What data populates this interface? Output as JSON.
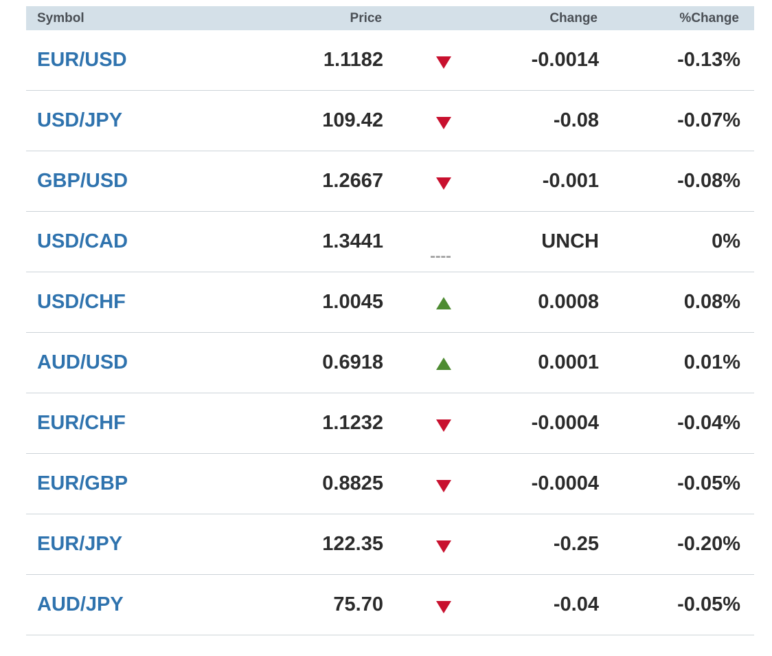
{
  "header": {
    "symbol": "Symbol",
    "price": "Price",
    "change": "Change",
    "pct_change": "%Change"
  },
  "colors": {
    "header_bg": "#d4e0e8",
    "symbol_link": "#2f73ae",
    "down": "#c8102e",
    "up": "#4d8b31",
    "flat": "#a8a8a8"
  },
  "rows": [
    {
      "symbol": "EUR/USD",
      "price": "1.1182",
      "direction": "down",
      "change": "-0.0014",
      "pct_change": "-0.13%"
    },
    {
      "symbol": "USD/JPY",
      "price": "109.42",
      "direction": "down",
      "change": "-0.08",
      "pct_change": "-0.07%"
    },
    {
      "symbol": "GBP/USD",
      "price": "1.2667",
      "direction": "down",
      "change": "-0.001",
      "pct_change": "-0.08%"
    },
    {
      "symbol": "USD/CAD",
      "price": "1.3441",
      "direction": "flat",
      "change": "UNCH",
      "pct_change": "0%"
    },
    {
      "symbol": "USD/CHF",
      "price": "1.0045",
      "direction": "up",
      "change": "0.0008",
      "pct_change": "0.08%"
    },
    {
      "symbol": "AUD/USD",
      "price": "0.6918",
      "direction": "up",
      "change": "0.0001",
      "pct_change": "0.01%"
    },
    {
      "symbol": "EUR/CHF",
      "price": "1.1232",
      "direction": "down",
      "change": "-0.0004",
      "pct_change": "-0.04%"
    },
    {
      "symbol": "EUR/GBP",
      "price": "0.8825",
      "direction": "down",
      "change": "-0.0004",
      "pct_change": "-0.05%"
    },
    {
      "symbol": "EUR/JPY",
      "price": "122.35",
      "direction": "down",
      "change": "-0.25",
      "pct_change": "-0.20%"
    },
    {
      "symbol": "AUD/JPY",
      "price": "75.70",
      "direction": "down",
      "change": "-0.04",
      "pct_change": "-0.05%"
    }
  ]
}
